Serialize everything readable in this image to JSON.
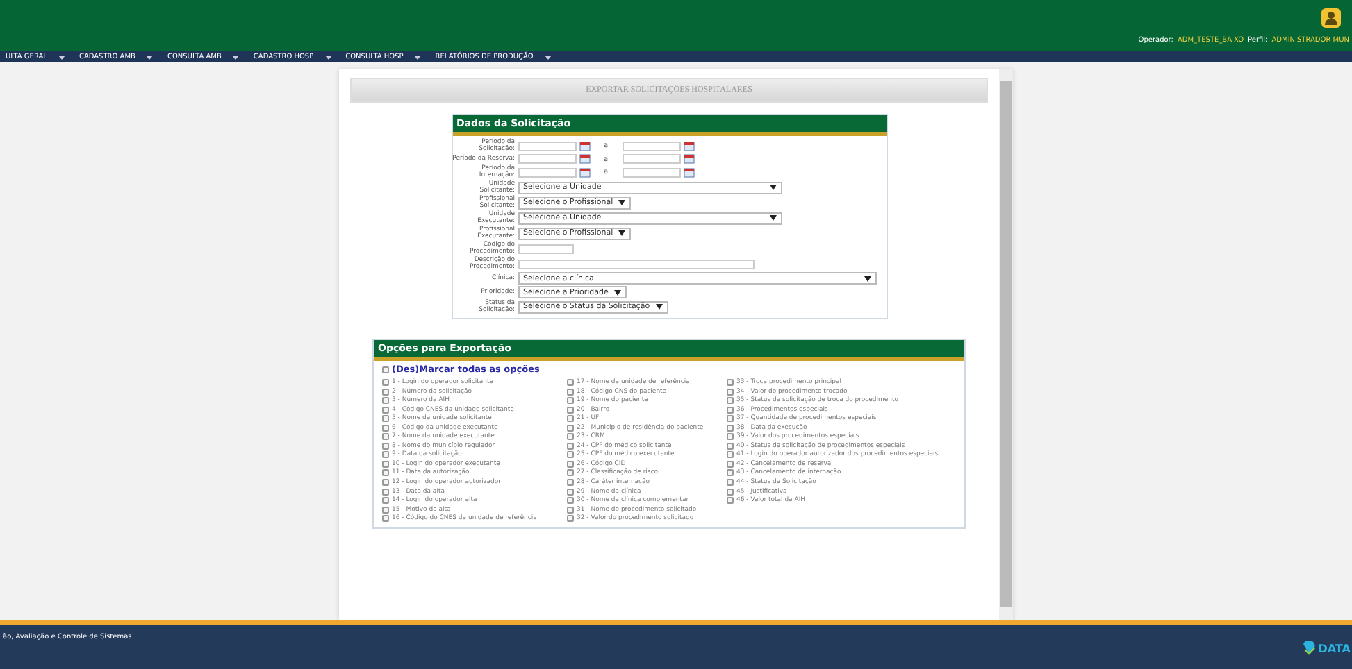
{
  "header": {
    "operator_label": "Operador:",
    "operator": "ADM_TESTE_BAIXO",
    "profile_label": "Perfil:",
    "profile": "ADMINISTRADOR MUN"
  },
  "menu": [
    {
      "label": "ULTA GERAL"
    },
    {
      "label": "CADASTRO AMB"
    },
    {
      "label": "CONSULTA AMB"
    },
    {
      "label": "CADASTRO HOSP"
    },
    {
      "label": "CONSULTA HOSP"
    },
    {
      "label": "RELATÓRIOS DE PRODUÇÃO"
    }
  ],
  "page_title": "EXPORTAR SOLICITAÇÕES HOSPITALARES",
  "request_panel": {
    "title": "Dados da Solicitação",
    "fields": [
      {
        "kind": "date_range",
        "label": "Período da Solicitação:",
        "separator": "a"
      },
      {
        "kind": "date_range",
        "label": "Período da Reserva:",
        "separator": "a"
      },
      {
        "kind": "date_range",
        "label": "Período da Internação:",
        "separator": "a"
      },
      {
        "kind": "select",
        "label": "Unidade Solicitante:",
        "value": "Selecione a Unidade"
      },
      {
        "kind": "select",
        "label": "Profissional Solicitante:",
        "value": "Selecione o Profissional"
      },
      {
        "kind": "select",
        "label": "Unidade Executante:",
        "value": "Selecione a Unidade"
      },
      {
        "kind": "select",
        "label": "Profissional Executante:",
        "value": "Selecione o Profissional"
      },
      {
        "kind": "input",
        "label": "Código do Procedimento:"
      },
      {
        "kind": "input",
        "label": "Descrição do Procedimento:"
      },
      {
        "kind": "select",
        "label": "Clínica:",
        "value": "Selecione a clínica"
      },
      {
        "kind": "select",
        "label": "Prioridade:",
        "value": "Selecione a Prioridade"
      },
      {
        "kind": "select",
        "label": "Status da Solicitação:",
        "value": "Selecione o Status da Solicitação"
      }
    ]
  },
  "export_panel": {
    "title": "Opções para Exportação",
    "toggle_all": {
      "label": "(Des)Marcar todas as opções",
      "checked": false
    },
    "columns": [
      [
        {
          "label": "1 - Login do operador solicitante",
          "checked": false
        },
        {
          "label": "2 - Número da solicitação",
          "checked": false
        },
        {
          "label": "3 - Número da AIH",
          "checked": false
        },
        {
          "label": "4 - Código CNES da unidade solicitante",
          "checked": false
        },
        {
          "label": "5 - Nome da unidade solicitante",
          "checked": false
        },
        {
          "label": "6 - Código da unidade executante",
          "checked": false
        },
        {
          "label": "7 - Nome da unidade executante",
          "checked": false
        },
        {
          "label": "8 - Nome do município regulador",
          "checked": false
        },
        {
          "label": "9 - Data da solicitação",
          "checked": false
        },
        {
          "label": "10 - Login do operador executante",
          "checked": false
        },
        {
          "label": "11 - Data da autorização",
          "checked": false
        },
        {
          "label": "12 - Login do operador autorizador",
          "checked": false
        },
        {
          "label": "13 - Data da alta",
          "checked": false
        },
        {
          "label": "14 - Login do operador alta",
          "checked": false
        },
        {
          "label": "15 - Motivo da alta",
          "checked": false
        },
        {
          "label": "16 - Código do CNES da unidade de referência",
          "checked": false
        }
      ],
      [
        {
          "label": "17 - Nome da unidade de referência",
          "checked": false
        },
        {
          "label": "18 - Código CNS do paciente",
          "checked": false
        },
        {
          "label": "19 - Nome do paciente",
          "checked": false
        },
        {
          "label": "20 - Bairro",
          "checked": false
        },
        {
          "label": "21 - UF",
          "checked": false
        },
        {
          "label": "22 - Município de residência do paciente",
          "checked": false
        },
        {
          "label": "23 - CRM",
          "checked": false
        },
        {
          "label": "24 - CPF do médico solicitante",
          "checked": false
        },
        {
          "label": "25 - CPF do médico executante",
          "checked": false
        },
        {
          "label": "26 - Código CID",
          "checked": false
        },
        {
          "label": "27 - Classificação de risco",
          "checked": false
        },
        {
          "label": "28 - Caráter internação",
          "checked": false
        },
        {
          "label": "29 - Nome da clínica",
          "checked": false
        },
        {
          "label": "30 - Nome da clínica complementar",
          "checked": false
        },
        {
          "label": "31 - Nome do procedimento solicitado",
          "checked": false
        },
        {
          "label": "32 - Valor do procedimento solicitado",
          "checked": false
        }
      ],
      [
        {
          "label": "33 - Troca procedimento principal",
          "checked": false
        },
        {
          "label": "34 - Valor do procedimento trocado",
          "checked": false
        },
        {
          "label": "35 - Status da solicitação de troca do procedimento",
          "checked": false
        },
        {
          "label": "36 - Procedimentos especiais",
          "checked": false
        },
        {
          "label": "37 - Quantidade de procedimentos especiais",
          "checked": false
        },
        {
          "label": "38 - Data da execução",
          "checked": false
        },
        {
          "label": "39 - Valor dos procedimentos especiais",
          "checked": false
        },
        {
          "label": "40 - Status da solicitação de procedimentos especiais",
          "checked": false
        },
        {
          "label": "41 - Login do operador autorizador dos procedimentos especiais",
          "checked": false
        },
        {
          "label": "42 - Cancelamento de reserva",
          "checked": false
        },
        {
          "label": "43 - Cancelamento de internação",
          "checked": false
        },
        {
          "label": "44 - Status da Solicitação",
          "checked": false
        },
        {
          "label": "45 - Justificativa",
          "checked": false
        },
        {
          "label": "46 - Valor total da AIH",
          "checked": false
        }
      ]
    ]
  },
  "footer": {
    "text": "ão, Avaliação e Controle de Sistemas",
    "logo": "DATA"
  }
}
